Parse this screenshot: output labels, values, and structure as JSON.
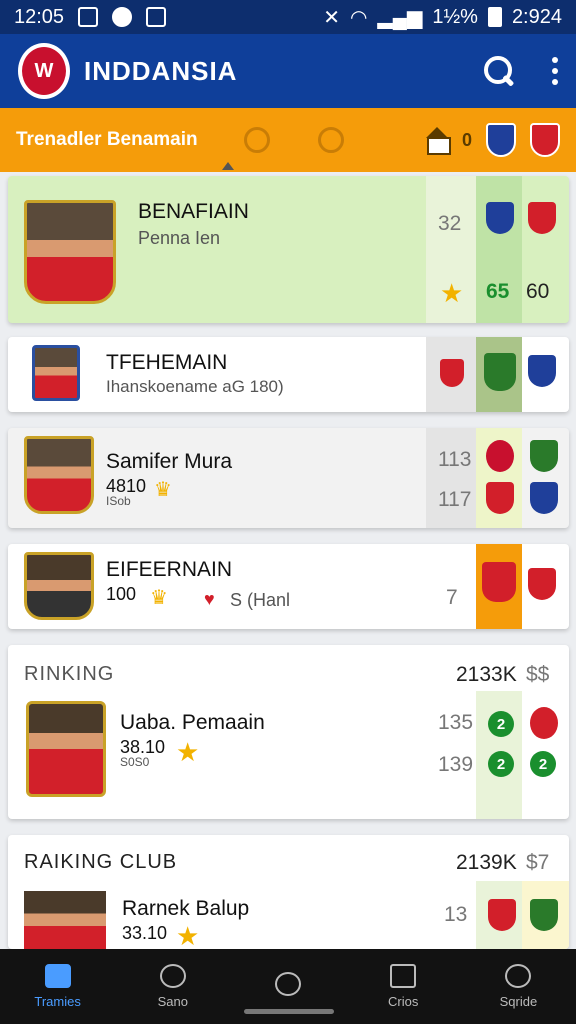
{
  "status_bar": {
    "time": "12:05",
    "battery": "1½%",
    "clock": "2:924"
  },
  "app": {
    "title": "INDDANSIA",
    "logo_text": "W"
  },
  "tabbar": {
    "label": "Trenadler Benamain",
    "badge": "0"
  },
  "cards": [
    {
      "name": "BENAFIAIN",
      "sub": "Penna Ien",
      "num1": "32",
      "score1": "65",
      "score2": "60"
    },
    {
      "name": "TFEHEMAIN",
      "sub": "Ihanskoename aG 180)"
    },
    {
      "name": "Samifer Mura",
      "stat": "4810",
      "stat_small": "ISob",
      "num1": "113",
      "num2": "117"
    },
    {
      "name": "EIFEERNAIN",
      "stat": "100",
      "extra": "S (Hanl",
      "num1": "7"
    }
  ],
  "ranking": {
    "title": "RINKING",
    "value": "2133K",
    "unit": "$$",
    "name": "Uaba. Pemaain",
    "stat": "38.10",
    "stat_small": "S0S0",
    "num1": "135",
    "num2": "139",
    "badge": "2"
  },
  "ranking_club": {
    "title": "RAIKING CLUB",
    "value": "2139K",
    "unit": "$7",
    "name": "Rarnek Balup",
    "stat": "33.10",
    "num1": "13"
  },
  "bottom_nav": [
    {
      "label": "Tramies"
    },
    {
      "label": "Sano"
    },
    {
      "label": ""
    },
    {
      "label": "Crios"
    },
    {
      "label": "Sqride"
    }
  ],
  "colors": {
    "primary": "#0f3f9a",
    "accent": "#f59c0a",
    "card_highlight": "#d8f0bf"
  }
}
